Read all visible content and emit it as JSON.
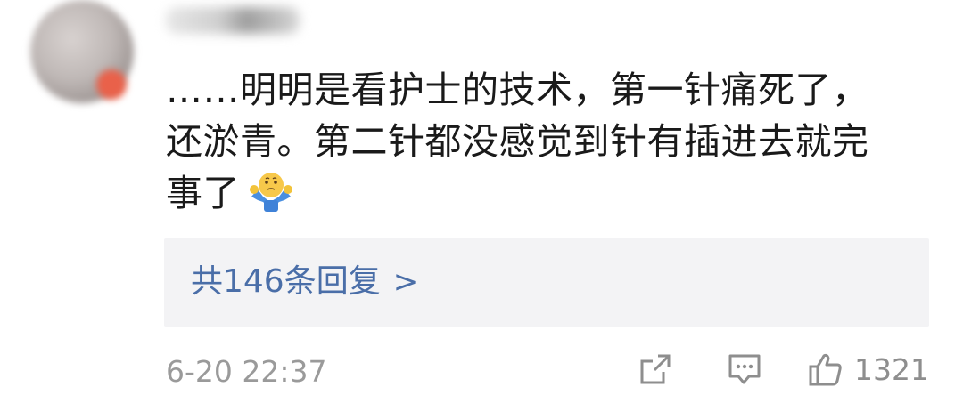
{
  "comment": {
    "text_line1": "……明明是看护士的技术，第一针痛死了，",
    "text_line2": "还淤青。第二针都没感觉到针有插进去就完",
    "text_line3": "事了",
    "emoji": "shrug-emoji"
  },
  "replies": {
    "label": "共146条回复",
    "chevron": ">"
  },
  "footer": {
    "timestamp": "6-20 22:37",
    "likes": "1321"
  },
  "colors": {
    "link": "#4a6ea8",
    "text": "#1a1a1a",
    "muted": "#9a9a9a",
    "reply_bg": "#f3f3f5"
  },
  "icons": {
    "share": "share-icon",
    "comment": "comment-icon",
    "like": "thumbs-up-icon"
  }
}
